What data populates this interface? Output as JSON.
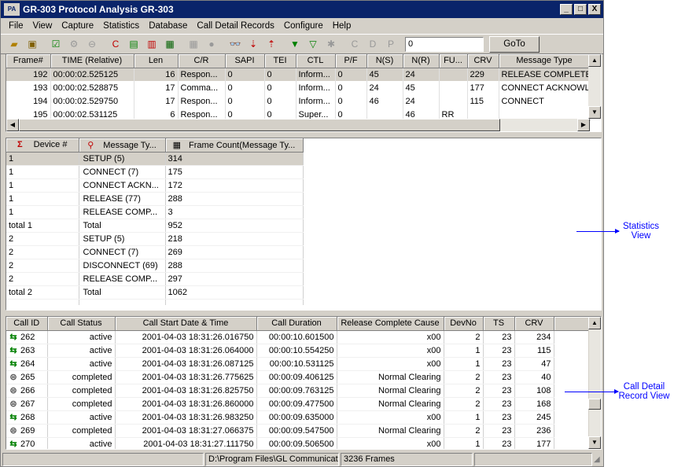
{
  "window": {
    "title": "GR-303 Protocol Analysis GR-303",
    "app_icon": "PA",
    "controls": {
      "minimize": "_",
      "maximize": "□",
      "close": "X"
    }
  },
  "menu": [
    "File",
    "View",
    "Capture",
    "Statistics",
    "Database",
    "Call Detail Records",
    "Configure",
    "Help"
  ],
  "toolbar": {
    "goto_value": "0",
    "goto_label": "GoTo"
  },
  "frames": {
    "columns": [
      "Frame#",
      "TIME (Relative)",
      "Len",
      "C/R",
      "SAPI",
      "TEI",
      "CTL",
      "P/F",
      "N(S)",
      "N(R)",
      "FU...",
      "CRV",
      "Message Type"
    ],
    "rows": [
      [
        "192",
        "00:00:02.525125",
        "16",
        "Respon...",
        "0",
        "0",
        "Inform...",
        "0",
        "45",
        "24",
        "",
        "229",
        "RELEASE COMPLETE"
      ],
      [
        "193",
        "00:00:02.528875",
        "17",
        "Comma...",
        "0",
        "0",
        "Inform...",
        "0",
        "24",
        "45",
        "",
        "177",
        "CONNECT ACKNOWL"
      ],
      [
        "194",
        "00:00:02.529750",
        "17",
        "Respon...",
        "0",
        "0",
        "Inform...",
        "0",
        "46",
        "24",
        "",
        "115",
        "CONNECT"
      ],
      [
        "195",
        "00:00:02.531125",
        "6",
        "Respon...",
        "0",
        "0",
        "Super...",
        "0",
        "",
        "46",
        "RR",
        "",
        ""
      ]
    ]
  },
  "statistics": {
    "columns": [
      "Device #",
      "Message Ty...",
      "Frame Count(Message Ty..."
    ],
    "rows": [
      [
        "1",
        "SETUP (5)",
        "314"
      ],
      [
        "1",
        "CONNECT (7)",
        "175"
      ],
      [
        "1",
        "CONNECT ACKN...",
        "172"
      ],
      [
        "1",
        "RELEASE (77)",
        "288"
      ],
      [
        "1",
        "RELEASE COMP...",
        "3"
      ],
      [
        "total 1",
        "Total",
        "952"
      ],
      [
        "2",
        "SETUP (5)",
        "218"
      ],
      [
        "2",
        "CONNECT (7)",
        "269"
      ],
      [
        "2",
        "DISCONNECT (69)",
        "288"
      ],
      [
        "2",
        "RELEASE COMP...",
        "297"
      ],
      [
        "total 2",
        "Total",
        "1062"
      ]
    ]
  },
  "cdr": {
    "columns": [
      "Call ID",
      "Call Status",
      "Call Start Date & Time",
      "Call Duration",
      "Release Complete Cause",
      "DevNo",
      "TS",
      "CRV"
    ],
    "rows": [
      [
        "262",
        "active",
        "2001-04-03 18:31:26.016750",
        "00:00:10.601500",
        "x00",
        "2",
        "23",
        "234"
      ],
      [
        "263",
        "active",
        "2001-04-03 18:31:26.064000",
        "00:00:10.554250",
        "x00",
        "1",
        "23",
        "115"
      ],
      [
        "264",
        "active",
        "2001-04-03 18:31:26.087125",
        "00:00:10.531125",
        "x00",
        "1",
        "23",
        "47"
      ],
      [
        "265",
        "completed",
        "2001-04-03 18:31:26.775625",
        "00:00:09.406125",
        "Normal Clearing",
        "2",
        "23",
        "40"
      ],
      [
        "266",
        "completed",
        "2001-04-03 18:31:26.825750",
        "00:00:09.763125",
        "Normal Clearing",
        "2",
        "23",
        "108"
      ],
      [
        "267",
        "completed",
        "2001-04-03 18:31:26.860000",
        "00:00:09.477500",
        "Normal Clearing",
        "2",
        "23",
        "168"
      ],
      [
        "268",
        "active",
        "2001-04-03 18:31:26.983250",
        "00:00:09.635000",
        "x00",
        "1",
        "23",
        "245"
      ],
      [
        "269",
        "completed",
        "2001-04-03 18:31:27.066375",
        "00:00:09.547500",
        "Normal Clearing",
        "2",
        "23",
        "236"
      ],
      [
        "270",
        "active",
        "2001-04-03 18:31:27.111750",
        "00:00:09.506500",
        "x00",
        "1",
        "23",
        "177"
      ]
    ]
  },
  "statusbar": {
    "path": "D:\\Program Files\\GL Communicatio",
    "frames": "3236 Frames"
  },
  "annotations": {
    "statistics": "Statistics View",
    "cdr": "Call Detail Record View"
  },
  "colors": {
    "titlebar": "#0a246a",
    "selected_row": "#d4d0c8",
    "annotation": "#0000ff"
  }
}
